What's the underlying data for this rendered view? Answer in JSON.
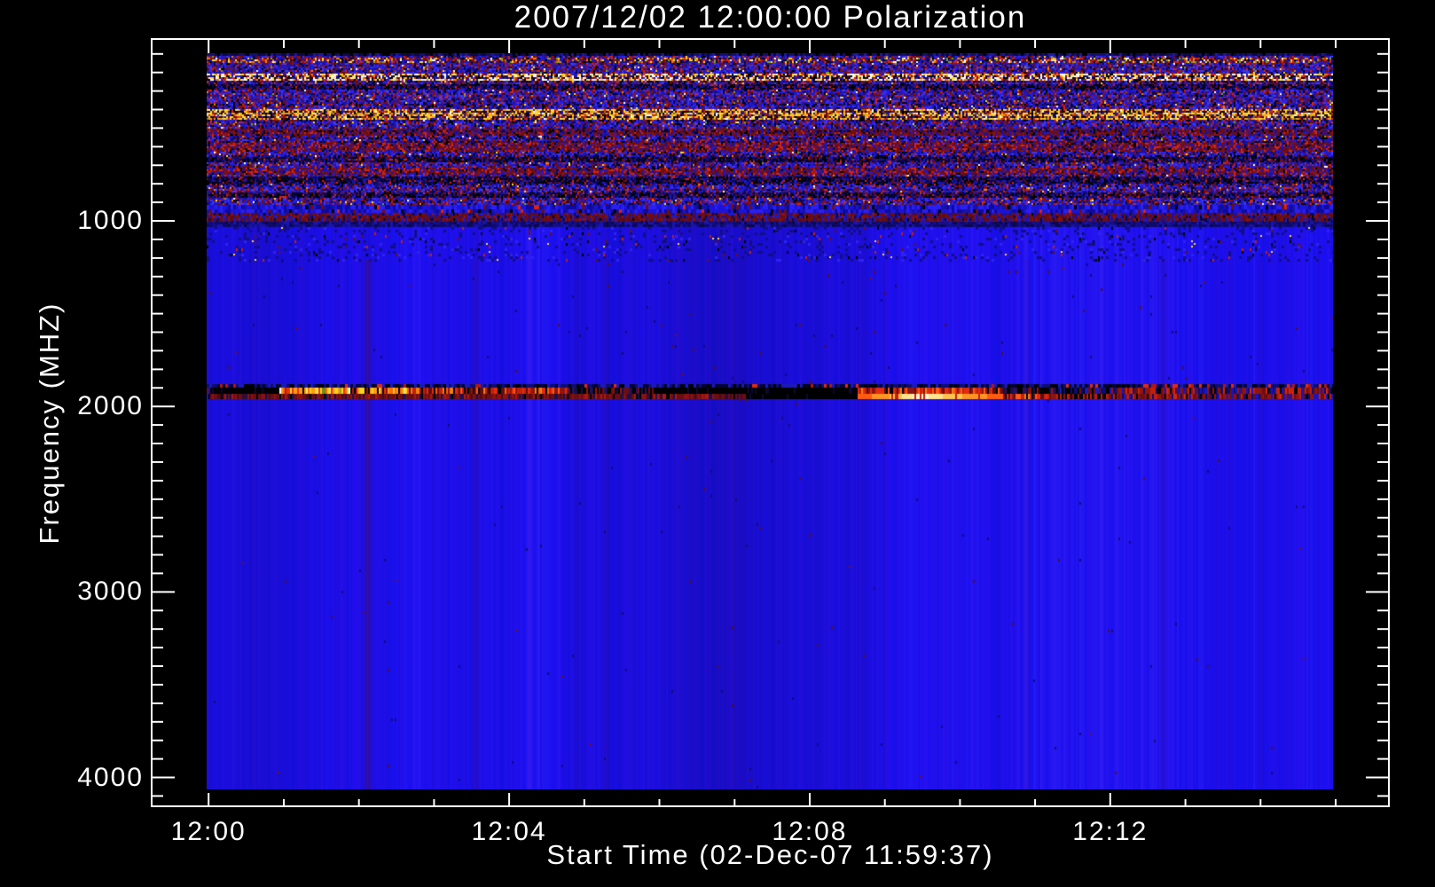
{
  "page": {
    "background": "#000000",
    "text_color": "#ffffff"
  },
  "chart_data": {
    "type": "heatmap",
    "title": "2007/12/02 12:00:00 Polarization",
    "xlabel": "Start Time (02-Dec-07 11:59:37)",
    "ylabel": "Frequency (MHZ)",
    "x_tick_labels": [
      "12:00",
      "12:04",
      "12:08",
      "12:12"
    ],
    "x_tick_minutes": [
      0,
      4,
      8,
      12
    ],
    "x_minor_tick_step_minutes": 1,
    "x_axis_range_minutes": [
      -0.77,
      15.72
    ],
    "y_tick_labels": [
      "1000",
      "2000",
      "3000",
      "4000"
    ],
    "y_tick_values": [
      1000,
      2000,
      3000,
      4000
    ],
    "y_minor_tick_step_mhz": 100,
    "y_axis_range_mhz": [
      15,
      4160
    ],
    "data_time_range_minutes": [
      0,
      14.98
    ],
    "data_freq_range_mhz": [
      96,
      4062
    ],
    "frame_color": "#ffffff",
    "interference_band_mhz": [
      1898,
      1960
    ],
    "legend": "none",
    "grid": "off",
    "palettes": {
      "noise_base": [
        [
          "#2018c8",
          16
        ],
        [
          "#2a22ee",
          15
        ],
        [
          "#1712a6",
          13
        ],
        [
          "#3c35f8",
          7
        ],
        [
          "#0a0848",
          10
        ],
        [
          "#000000",
          6
        ],
        [
          "#6b0e12",
          12
        ],
        [
          "#8a1212",
          8
        ],
        [
          "#d42510",
          5
        ],
        [
          "#f08010",
          1.2
        ],
        [
          "#ffd92e",
          0.8
        ],
        [
          "#ffffff",
          0.4
        ],
        [
          "#7fa012",
          0.5
        ],
        [
          "#b01878",
          0.6
        ],
        [
          "#4a3acd",
          4
        ]
      ],
      "edge_dark": [
        [
          "#0a0848",
          40
        ],
        [
          "#000000",
          15
        ],
        [
          "#131070",
          30
        ],
        [
          "#1d18a8",
          15
        ]
      ],
      "speckle_bright": [
        [
          "#2018c8",
          18
        ],
        [
          "#1712a6",
          12
        ],
        [
          "#0a0848",
          8
        ],
        [
          "#000000",
          6
        ],
        [
          "#6b0e12",
          10
        ],
        [
          "#d42510",
          14
        ],
        [
          "#f08010",
          7
        ],
        [
          "#ffd92e",
          8
        ],
        [
          "#7fa012",
          5
        ],
        [
          "#ffffff",
          3
        ],
        [
          "#8a1212",
          9
        ]
      ],
      "white_line": [
        [
          "#ffffff",
          20
        ],
        [
          "#ffe9a0",
          12
        ],
        [
          "#ffd92e",
          16
        ],
        [
          "#f08010",
          14
        ],
        [
          "#d42510",
          14
        ],
        [
          "#000000",
          8
        ],
        [
          "#2018c8",
          10
        ],
        [
          "#6b0e12",
          6
        ]
      ],
      "yellow_band": [
        [
          "#ffd92e",
          26
        ],
        [
          "#f0a012",
          20
        ],
        [
          "#ffffff",
          5
        ],
        [
          "#d42510",
          13
        ],
        [
          "#000000",
          12
        ],
        [
          "#6b0e12",
          9
        ],
        [
          "#2018c8",
          9
        ],
        [
          "#8a6a10",
          6
        ]
      ],
      "dark_row": [
        [
          "#000000",
          28
        ],
        [
          "#0a0848",
          28
        ],
        [
          "#6b0e12",
          14
        ],
        [
          "#1712a6",
          18
        ],
        [
          "#d42510",
          5
        ],
        [
          "#2018c8",
          7
        ]
      ],
      "maroon_row": [
        [
          "#6b0e12",
          40
        ],
        [
          "#8a1212",
          18
        ],
        [
          "#000000",
          10
        ],
        [
          "#1712a6",
          16
        ],
        [
          "#d42510",
          6
        ],
        [
          "#2018c8",
          10
        ]
      ],
      "red_row": [
        [
          "#d42510",
          16
        ],
        [
          "#6b0e12",
          30
        ],
        [
          "#8a1212",
          16
        ],
        [
          "#1712a6",
          14
        ],
        [
          "#000000",
          8
        ],
        [
          "#2018c8",
          16
        ]
      ],
      "blue_dash": [
        [
          "#1b14d8",
          30
        ],
        [
          "#2a1ff2",
          25
        ],
        [
          "#0e0a9e",
          25
        ],
        [
          "#1712a6",
          12
        ],
        [
          "#000000",
          3
        ],
        [
          "#6b0e12",
          3
        ],
        [
          "#d42510",
          2
        ]
      ],
      "maroon_band": [
        [
          "#6b0e12",
          34
        ],
        [
          "#5a0c16",
          16
        ],
        [
          "#8a1212",
          10
        ],
        [
          "#1712a6",
          16
        ],
        [
          "#0a0848",
          10
        ],
        [
          "#2018c8",
          12
        ],
        [
          "#000000",
          2
        ]
      ],
      "navy_band": [
        [
          "#0d0a6a",
          35
        ],
        [
          "#120f8a",
          30
        ],
        [
          "#1a14b0",
          20
        ],
        [
          "#0a0848",
          15
        ]
      ],
      "band_black": [
        [
          "#000000",
          92
        ],
        [
          "#0d0830",
          8
        ]
      ],
      "band_maroon": [
        [
          "#6b0e12",
          36
        ],
        [
          "#8a1212",
          20
        ],
        [
          "#4a0a16",
          14
        ],
        [
          "#a81a0e",
          10
        ],
        [
          "#1a1050",
          10
        ],
        [
          "#000000",
          10
        ]
      ],
      "band_bright": [
        [
          "#ffd31f",
          22
        ],
        [
          "#ff9b12",
          20
        ],
        [
          "#ff6a08",
          14
        ],
        [
          "#e63311",
          14
        ],
        [
          "#ffe95e",
          8
        ],
        [
          "#b01a0c",
          10
        ],
        [
          "#000000",
          6
        ],
        [
          "#ffffff",
          3
        ],
        [
          "#8f1410",
          3
        ]
      ],
      "band_green": [
        [
          "#93a81a",
          25
        ],
        [
          "#c8c21e",
          15
        ],
        [
          "#6d8c12",
          15
        ],
        [
          "#ffd31f",
          15
        ],
        [
          "#f08010",
          10
        ],
        [
          "#e63311",
          10
        ],
        [
          "#000000",
          10
        ]
      ],
      "band_red": [
        [
          "#e02c10",
          22
        ],
        [
          "#c32008",
          18
        ],
        [
          "#8f1410",
          18
        ],
        [
          "#ff5a12",
          10
        ],
        [
          "#600d10",
          14
        ],
        [
          "#000000",
          10
        ],
        [
          "#f08010",
          8
        ]
      ],
      "band_darkdash": [
        [
          "#000000",
          40
        ],
        [
          "#14104a",
          22
        ],
        [
          "#30105a",
          12
        ],
        [
          "#6b0e12",
          16
        ],
        [
          "#8f1410",
          10
        ]
      ],
      "band_bluedark": [
        [
          "#181abf",
          30
        ],
        [
          "#0d0d70",
          25
        ],
        [
          "#000000",
          25
        ],
        [
          "#6b0e12",
          20
        ]
      ],
      "band_blackred": [
        [
          "#000000",
          55
        ],
        [
          "#c32008",
          20
        ],
        [
          "#8f1410",
          20
        ],
        [
          "#1a1050",
          5
        ]
      ],
      "band_fade": [
        [
          "#8f1410",
          22
        ],
        [
          "#6b0e12",
          20
        ],
        [
          "#c32008",
          12
        ],
        [
          "#1a14c0",
          16
        ],
        [
          "#0d0d70",
          12
        ],
        [
          "#000000",
          12
        ],
        [
          "#d42510",
          6
        ]
      ],
      "dash_row_base": [
        [
          "#05052e",
          30
        ],
        [
          "#0e0e6e",
          28
        ],
        [
          "#1b1bb4",
          22
        ],
        [
          "#000000",
          20
        ]
      ]
    },
    "zones": [
      {
        "f0": 96,
        "f1": 112,
        "type": "rowfill",
        "palette": "edge_dark",
        "cw": 3,
        "ch": 3
      },
      {
        "f0": 112,
        "f1": 915,
        "type": "noise",
        "cw": 2,
        "ch": 2
      },
      {
        "f0": 915,
        "f1": 958,
        "type": "rowfill",
        "palette": "blue_dash",
        "cw": 3,
        "ch": 5
      },
      {
        "f0": 958,
        "f1": 1005,
        "type": "rowfill",
        "palette": "maroon_band",
        "cw": 2,
        "ch": 3
      },
      {
        "f0": 1005,
        "f1": 1035,
        "type": "rowfill",
        "palette": "navy_band",
        "cw": 3,
        "ch": 3
      },
      {
        "f0": 1035,
        "f1": 1210,
        "type": "textured"
      },
      {
        "f0": 1210,
        "f1": 1878,
        "type": "clean",
        "speck": 0.006
      },
      {
        "f0": 1878,
        "f1": 1898,
        "type": "dashrow"
      },
      {
        "f0": 1898,
        "f1": 1960,
        "type": "band"
      },
      {
        "f0": 1960,
        "f1": 4062,
        "type": "clean",
        "speck": 0.002
      }
    ],
    "noise_rows": [
      {
        "f0": 112,
        "f1": 148,
        "palette": "speckle_bright"
      },
      {
        "f0": 200,
        "f1": 240,
        "palette": "white_line"
      },
      {
        "f0": 262,
        "f1": 292,
        "palette": "dark_row"
      },
      {
        "f0": 395,
        "f1": 450,
        "palette": "yellow_band"
      },
      {
        "f0": 500,
        "f1": 532,
        "palette": "maroon_row"
      },
      {
        "f0": 568,
        "f1": 626,
        "palette": "red_row"
      },
      {
        "f0": 648,
        "f1": 684,
        "palette": "dark_row"
      },
      {
        "f0": 704,
        "f1": 750,
        "palette": "red_row"
      },
      {
        "f0": 760,
        "f1": 794,
        "palette": "dark_row"
      },
      {
        "f0": 838,
        "f1": 874,
        "palette": "dark_row"
      }
    ],
    "band_segments": [
      {
        "t0": 0.0,
        "t1": 0.92,
        "top": "band_black",
        "bot": "band_maroon"
      },
      {
        "t0": 0.92,
        "t1": 2.62,
        "top": "band_bright",
        "bot": "band_maroon",
        "green": [
          1.5,
          1.8
        ]
      },
      {
        "t0": 2.62,
        "t1": 4.78,
        "top": "band_red",
        "bot": "band_maroon"
      },
      {
        "t0": 4.78,
        "t1": 5.92,
        "top": "band_darkdash",
        "bot": "band_maroon"
      },
      {
        "t0": 5.92,
        "t1": 7.15,
        "top": "band_black",
        "bot": "band_maroon"
      },
      {
        "t0": 7.15,
        "t1": 8.62,
        "top": "band_black",
        "bot": "band_black"
      },
      {
        "t0": 8.62,
        "t1": 10.55,
        "top": "band_red",
        "bot": "CORE",
        "peak": 9.45
      },
      {
        "t0": 10.55,
        "t1": 11.3,
        "top": "band_darkdash",
        "bot": "band_red"
      },
      {
        "t0": 11.3,
        "t1": 11.92,
        "top": "band_bluedark",
        "bot": "band_blackred"
      },
      {
        "t0": 11.92,
        "t1": 15.0,
        "top": "band_fade",
        "bot": "band_fade"
      }
    ],
    "faint_columns": [
      {
        "t": 2.12,
        "halfw": 0.05,
        "alpha": 0.28
      },
      {
        "t": 3.55,
        "halfw": 0.04,
        "alpha": 0.1
      },
      {
        "t": 5.3,
        "halfw": 0.04,
        "alpha": 0.08
      },
      {
        "t": 7.0,
        "halfw": 0.04,
        "alpha": 0.08
      },
      {
        "t": 9.0,
        "halfw": 0.03,
        "alpha": 0.07
      },
      {
        "t": 10.9,
        "halfw": 0.04,
        "alpha": 0.08
      },
      {
        "t": 12.7,
        "halfw": 0.05,
        "alpha": 0.1
      },
      {
        "t": 14.0,
        "halfw": 0.04,
        "alpha": 0.07
      }
    ]
  }
}
